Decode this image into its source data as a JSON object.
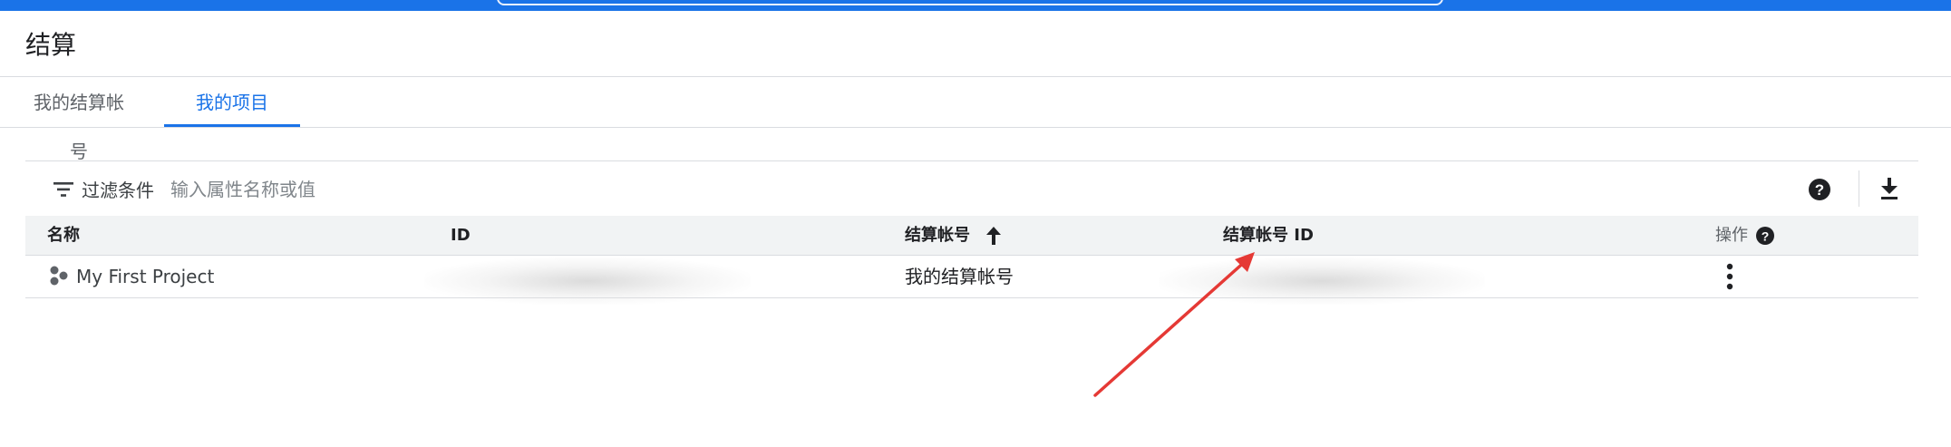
{
  "header": {
    "title": "结算"
  },
  "tabs": [
    {
      "label": "我的结算帐号",
      "active": false
    },
    {
      "label": "我的项目",
      "active": true
    }
  ],
  "filter": {
    "label": "过滤条件",
    "placeholder": "输入属性名称或值"
  },
  "toolbar": {
    "help_icon": "help-circle-icon",
    "download_icon": "download-icon"
  },
  "table": {
    "columns": [
      {
        "label": "名称"
      },
      {
        "label": "ID"
      },
      {
        "label": "结算帐号",
        "sort": "ascending"
      },
      {
        "label": "结算帐号 ID"
      },
      {
        "label": "操作"
      }
    ],
    "rows": [
      {
        "name": "My First Project",
        "id": "",
        "billing_account": "我的结算帐号",
        "billing_account_id": ""
      }
    ]
  },
  "colors": {
    "accent": "#1a73e8",
    "annotation_arrow": "#e53935"
  }
}
